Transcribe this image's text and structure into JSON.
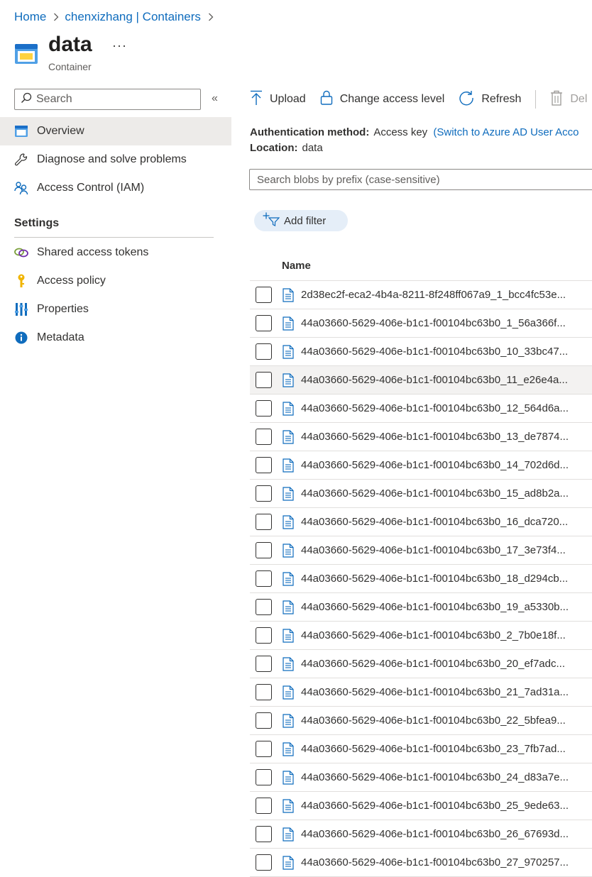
{
  "breadcrumb": {
    "home": "Home",
    "containers": "chenxizhang | Containers"
  },
  "header": {
    "title": "data",
    "subtitle": "Container",
    "more": "···",
    "icon": "storage-container-icon"
  },
  "sidebar": {
    "search_placeholder": "Search",
    "collapse_glyph": "«",
    "items": [
      {
        "label": "Overview",
        "icon": "overview-icon"
      },
      {
        "label": "Diagnose and solve problems",
        "icon": "wrench-icon"
      },
      {
        "label": "Access Control (IAM)",
        "icon": "people-icon"
      }
    ],
    "settings_title": "Settings",
    "settings_items": [
      {
        "label": "Shared access tokens",
        "icon": "link-icon"
      },
      {
        "label": "Access policy",
        "icon": "key-icon"
      },
      {
        "label": "Properties",
        "icon": "properties-icon"
      },
      {
        "label": "Metadata",
        "icon": "info-icon"
      }
    ]
  },
  "toolbar": {
    "upload": "Upload",
    "change_access": "Change access level",
    "refresh": "Refresh",
    "delete": "Del"
  },
  "info": {
    "auth_label": "Authentication method:",
    "auth_value": "Access key",
    "auth_link": "(Switch to Azure AD User Acco",
    "location_label": "Location:",
    "location_value": "data"
  },
  "blob_search": {
    "placeholder": "Search blobs by prefix (case-sensitive)"
  },
  "filter": {
    "add_label": "Add filter"
  },
  "table": {
    "column_name": "Name",
    "rows": [
      "2d38ec2f-eca2-4b4a-8211-8f248ff067a9_1_bcc4fc53e...",
      "44a03660-5629-406e-b1c1-f00104bc63b0_1_56a366f...",
      "44a03660-5629-406e-b1c1-f00104bc63b0_10_33bc47...",
      "44a03660-5629-406e-b1c1-f00104bc63b0_11_e26e4a...",
      "44a03660-5629-406e-b1c1-f00104bc63b0_12_564d6a...",
      "44a03660-5629-406e-b1c1-f00104bc63b0_13_de7874...",
      "44a03660-5629-406e-b1c1-f00104bc63b0_14_702d6d...",
      "44a03660-5629-406e-b1c1-f00104bc63b0_15_ad8b2a...",
      "44a03660-5629-406e-b1c1-f00104bc63b0_16_dca720...",
      "44a03660-5629-406e-b1c1-f00104bc63b0_17_3e73f4...",
      "44a03660-5629-406e-b1c1-f00104bc63b0_18_d294cb...",
      "44a03660-5629-406e-b1c1-f00104bc63b0_19_a5330b...",
      "44a03660-5629-406e-b1c1-f00104bc63b0_2_7b0e18f...",
      "44a03660-5629-406e-b1c1-f00104bc63b0_20_ef7adc...",
      "44a03660-5629-406e-b1c1-f00104bc63b0_21_7ad31a...",
      "44a03660-5629-406e-b1c1-f00104bc63b0_22_5bfea9...",
      "44a03660-5629-406e-b1c1-f00104bc63b0_23_7fb7ad...",
      "44a03660-5629-406e-b1c1-f00104bc63b0_24_d83a7e...",
      "44a03660-5629-406e-b1c1-f00104bc63b0_25_9ede63...",
      "44a03660-5629-406e-b1c1-f00104bc63b0_26_67693d...",
      "44a03660-5629-406e-b1c1-f00104bc63b0_27_970257..."
    ]
  },
  "colors": {
    "link": "#0f6cbd",
    "selected_nav": "#edebe9",
    "filter_pill": "#e5eef8",
    "row_hover": "#f3f2f1"
  }
}
